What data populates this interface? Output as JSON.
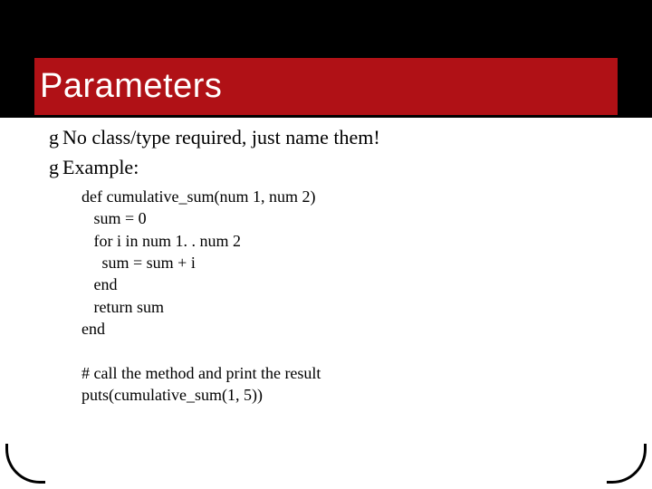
{
  "title": "Parameters",
  "bullets": [
    "No class/type required, just name them!",
    "Example:"
  ],
  "code": "def cumulative_sum(num 1, num 2)\n   sum = 0\n   for i in num 1. . num 2\n     sum = sum + i\n   end\n   return sum\nend\n\n# call the method and print the result\nputs(cumulative_sum(1, 5))"
}
